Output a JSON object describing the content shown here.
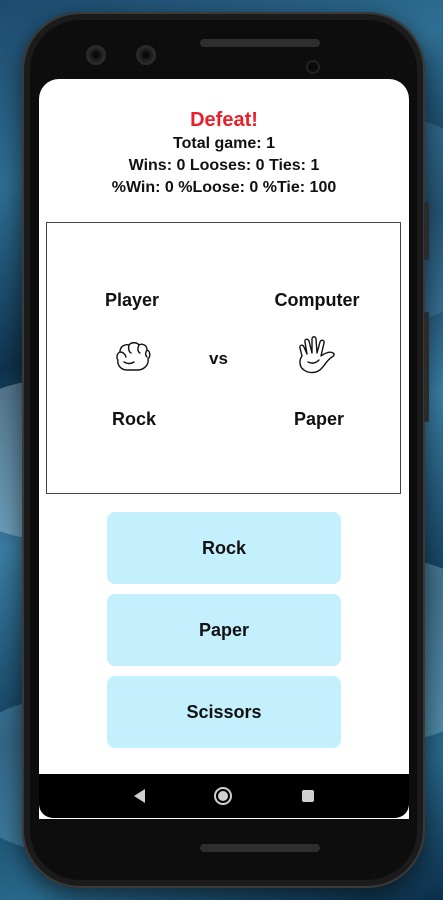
{
  "game": {
    "result": "Defeat!",
    "total_line": "Total game: 1",
    "counts_line": "Wins: 0 Looses: 0 Ties: 1",
    "percent_line": "%Win: 0 %Loose: 0 %Tie: 100"
  },
  "arena": {
    "player_label": "Player",
    "computer_label": "Computer",
    "vs_label": "vs",
    "player_choice": "Rock",
    "computer_choice": "Paper",
    "player_icon": "rock-hand-icon",
    "computer_icon": "paper-hand-icon"
  },
  "choices": [
    {
      "label": "Rock"
    },
    {
      "label": "Paper"
    },
    {
      "label": "Scissors"
    }
  ],
  "nav": {
    "back_icon": "back-icon",
    "home_icon": "home-icon",
    "recents_icon": "recents-icon"
  },
  "colors": {
    "result": "#e8202a",
    "button_bg": "#c4effc",
    "screen_bg": "#ffffff"
  }
}
